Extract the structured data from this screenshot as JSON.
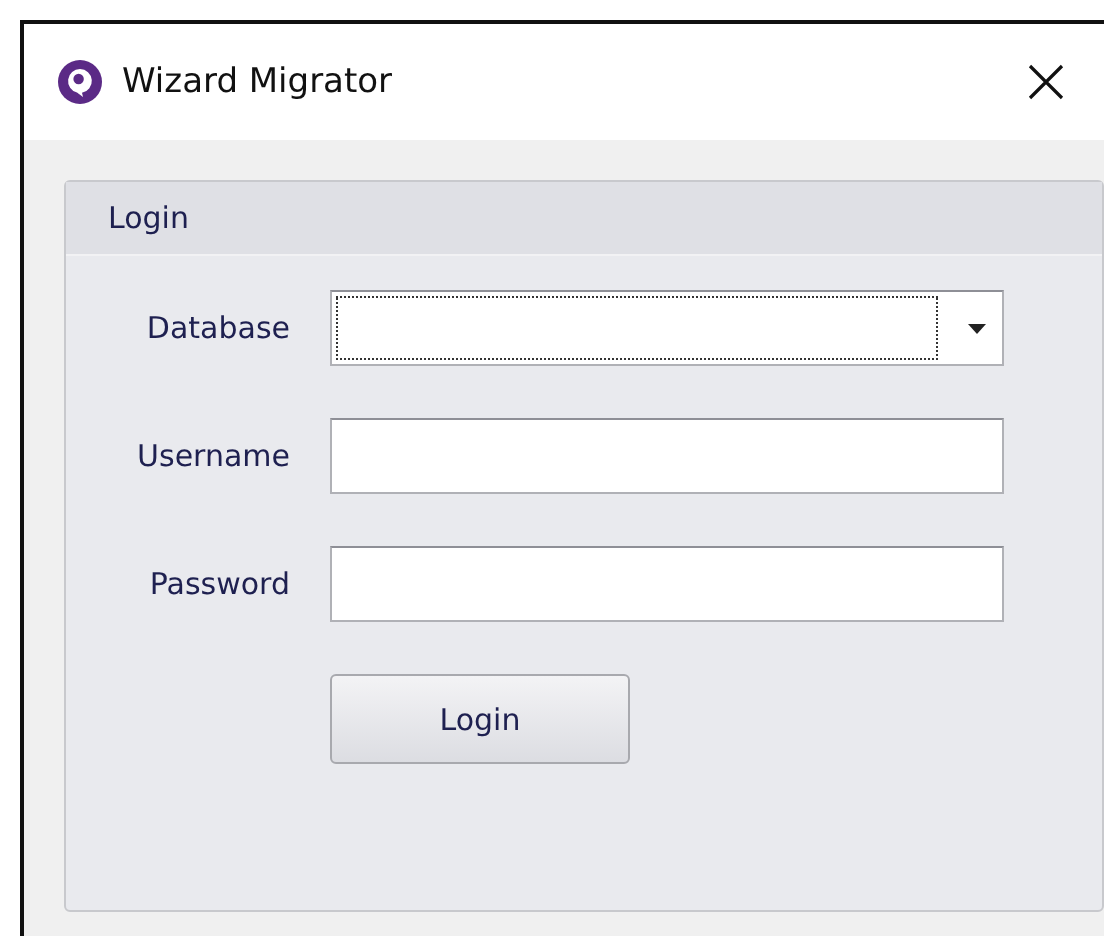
{
  "window": {
    "title": "Wizard Migrator"
  },
  "group": {
    "title": "Login"
  },
  "fields": [
    {
      "label": "Database",
      "kind": "combo",
      "focused": true
    },
    {
      "label": "Username",
      "kind": "text",
      "focused": false
    },
    {
      "label": "Password",
      "kind": "password",
      "focused": false
    }
  ],
  "button": "Login"
}
